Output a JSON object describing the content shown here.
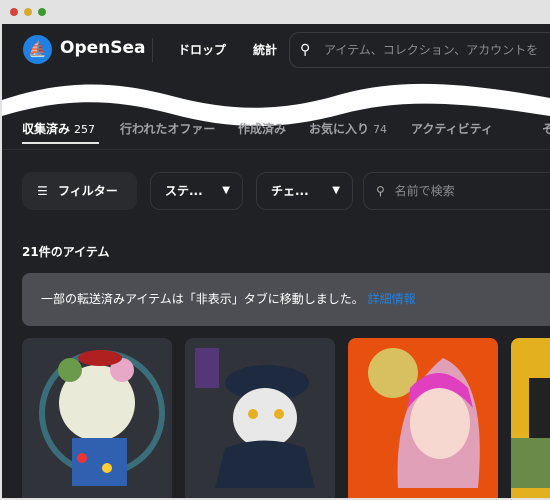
{
  "window": {
    "controls": {
      "close": "#d4463a",
      "minimize": "#d9a930",
      "zoom": "#3a9a2e"
    }
  },
  "header": {
    "brand": "OpenSea",
    "brand_color": "#2081e2",
    "logo_icon": "sailboat-icon",
    "nav": [
      "ドロップ",
      "統計"
    ],
    "search_placeholder": "アイテム、コレクション、アカウントを"
  },
  "tabs": [
    {
      "label": "収集済み",
      "count": "257",
      "active": true
    },
    {
      "label": "行われたオファー"
    },
    {
      "label": "作成済み"
    },
    {
      "label": "お気に入り",
      "count": "74"
    },
    {
      "label": "アクティビティ"
    },
    {
      "label": "そ"
    }
  ],
  "filters": {
    "filter_label": "フィルター",
    "status_label": "ステ...",
    "chain_label": "チェ...",
    "search_placeholder": "名前で検索"
  },
  "items_count": "21件のアイテム",
  "notice": {
    "text": "一部の転送済みアイテムは「非表示」タブに移動しました。",
    "link": "詳細情報",
    "link_color": "#2081e2"
  },
  "cards": [
    {
      "bg": "#303339",
      "subject": "panda painter"
    },
    {
      "bg": "#303339",
      "subject": "owl police officer"
    },
    {
      "bg": "#e8500f",
      "subject": "anime girl moon"
    },
    {
      "bg": "#e3b020",
      "subject": "partial card"
    }
  ]
}
